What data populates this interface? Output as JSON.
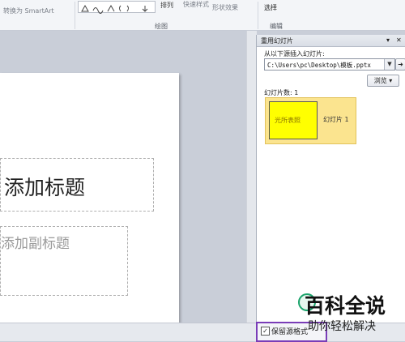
{
  "ribbon": {
    "smartart_label": "转换为 SmartArt",
    "arrange_label": "排列",
    "quick_styles_label": "快速样式",
    "shape_effects_label": "形状效果",
    "select_label": "选择",
    "drawing_group": "绘图",
    "editing_group": "编辑"
  },
  "slide": {
    "title_placeholder": "添加标题",
    "subtitle_placeholder": "添加副标题"
  },
  "pane": {
    "title": "重用幻灯片",
    "insert_from_label": "从以下源插入幻灯片:",
    "path_value": "C:\\Users\\pc\\Desktop\\模板.pptx",
    "browse_label": "浏览",
    "slides_label": "幻灯片数: 1",
    "slide_thumb_text": "光所表照",
    "slide_item_label": "幻灯片 1"
  },
  "footer": {
    "keep_format_label": "保留源格式"
  },
  "watermark": {
    "line1": "百科全说",
    "line2": "助你轻松解决"
  }
}
